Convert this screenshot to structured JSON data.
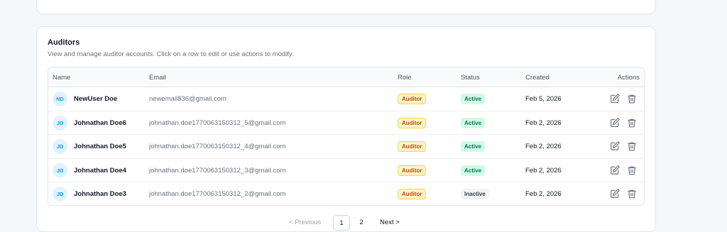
{
  "section": {
    "title": "Auditors",
    "description": "View and manage auditor accounts. Click on a row to edit or use actions to modify."
  },
  "table": {
    "columns": {
      "name": "Name",
      "email": "Email",
      "role": "Role",
      "status": "Status",
      "created": "Created",
      "actions": "Actions"
    },
    "rows": [
      {
        "initials": "ND",
        "name": "NewUser Doe",
        "email": "newemail836@gmail.com",
        "role": "Auditor",
        "status": "Active",
        "created": "Feb 5, 2026"
      },
      {
        "initials": "JD",
        "name": "Johnathan Doe6",
        "email": "johnathan.doe1770063150312_5@gmail.com",
        "role": "Auditor",
        "status": "Active",
        "created": "Feb 2, 2026"
      },
      {
        "initials": "JD",
        "name": "Johnathan Doe5",
        "email": "johnathan.doe1770063150312_4@gmail.com",
        "role": "Auditor",
        "status": "Active",
        "created": "Feb 2, 2026"
      },
      {
        "initials": "JD",
        "name": "Johnathan Doe4",
        "email": "johnathan.doe1770063150312_3@gmail.com",
        "role": "Auditor",
        "status": "Active",
        "created": "Feb 2, 2026"
      },
      {
        "initials": "JD",
        "name": "Johnathan Doe3",
        "email": "johnathan.doe1770063150312_2@gmail.com",
        "role": "Auditor",
        "status": "Inactive",
        "created": "Feb 2, 2026"
      }
    ],
    "action_icons": [
      "edit-icon",
      "trash-icon"
    ]
  },
  "pagination": {
    "previous_label": "< Previous",
    "pages": [
      "1",
      "2"
    ],
    "current_page": "1",
    "next_label": "Next >"
  },
  "colors": {
    "role_badge": "#fef3c7",
    "active_badge": "#d1fae5",
    "inactive_badge": "#f3f4f6",
    "avatar": "#e0f2fe"
  }
}
